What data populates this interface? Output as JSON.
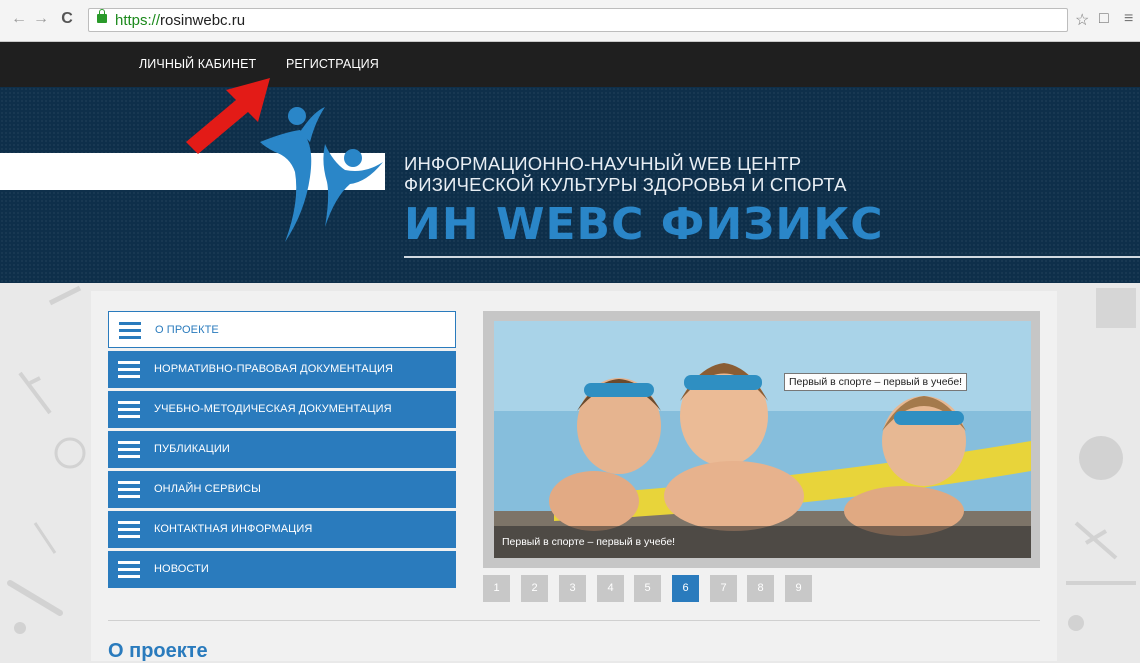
{
  "browser": {
    "url_scheme": "https://",
    "url_host": "rosinwebc.ru",
    "back_icon": "←",
    "forward_icon": "→",
    "reload_icon": "C",
    "star_icon": "☆",
    "cast_icon": "□",
    "menu_icon": "≡"
  },
  "topnav": {
    "items": [
      "ЛИЧНЫЙ КАБИНЕТ",
      "РЕГИСТРАЦИЯ"
    ]
  },
  "banner": {
    "tagline_line1": "ИНФОРМАЦИОННО-НАУЧНЫЙ WEB ЦЕНТР",
    "tagline_line2": "ФИЗИЧЕСКОЙ КУЛЬТУРЫ ЗДОРОВЬЯ И СПОРТА",
    "brand": "ИН WEBC ФИЗИКС"
  },
  "menu": {
    "items": [
      "О ПРОЕКТЕ",
      "НОРМАТИВНО-ПРАВОВАЯ ДОКУМЕНТАЦИЯ",
      "УЧЕБНО-МЕТОДИЧЕСКАЯ ДОКУМЕНТАЦИЯ",
      "ПУБЛИКАЦИИ",
      "ОНЛАЙН СЕРВИСЫ",
      "КОНТАКТНАЯ ИНФОРМАЦИЯ",
      "НОВОСТИ"
    ],
    "active_index": 0
  },
  "slider": {
    "caption": "Первый в спорте – первый в учебе!",
    "tooltip": "Первый в спорте – первый в учебе!",
    "pages": [
      "1",
      "2",
      "3",
      "4",
      "5",
      "6",
      "7",
      "8",
      "9"
    ],
    "active_page": "6"
  },
  "section": {
    "title": "О проекте"
  },
  "colors": {
    "accent": "#2a7bbd",
    "banner_bg": "#0e2f4a",
    "topnav_bg": "#1f1f1f",
    "arrow": "#e31b17"
  }
}
